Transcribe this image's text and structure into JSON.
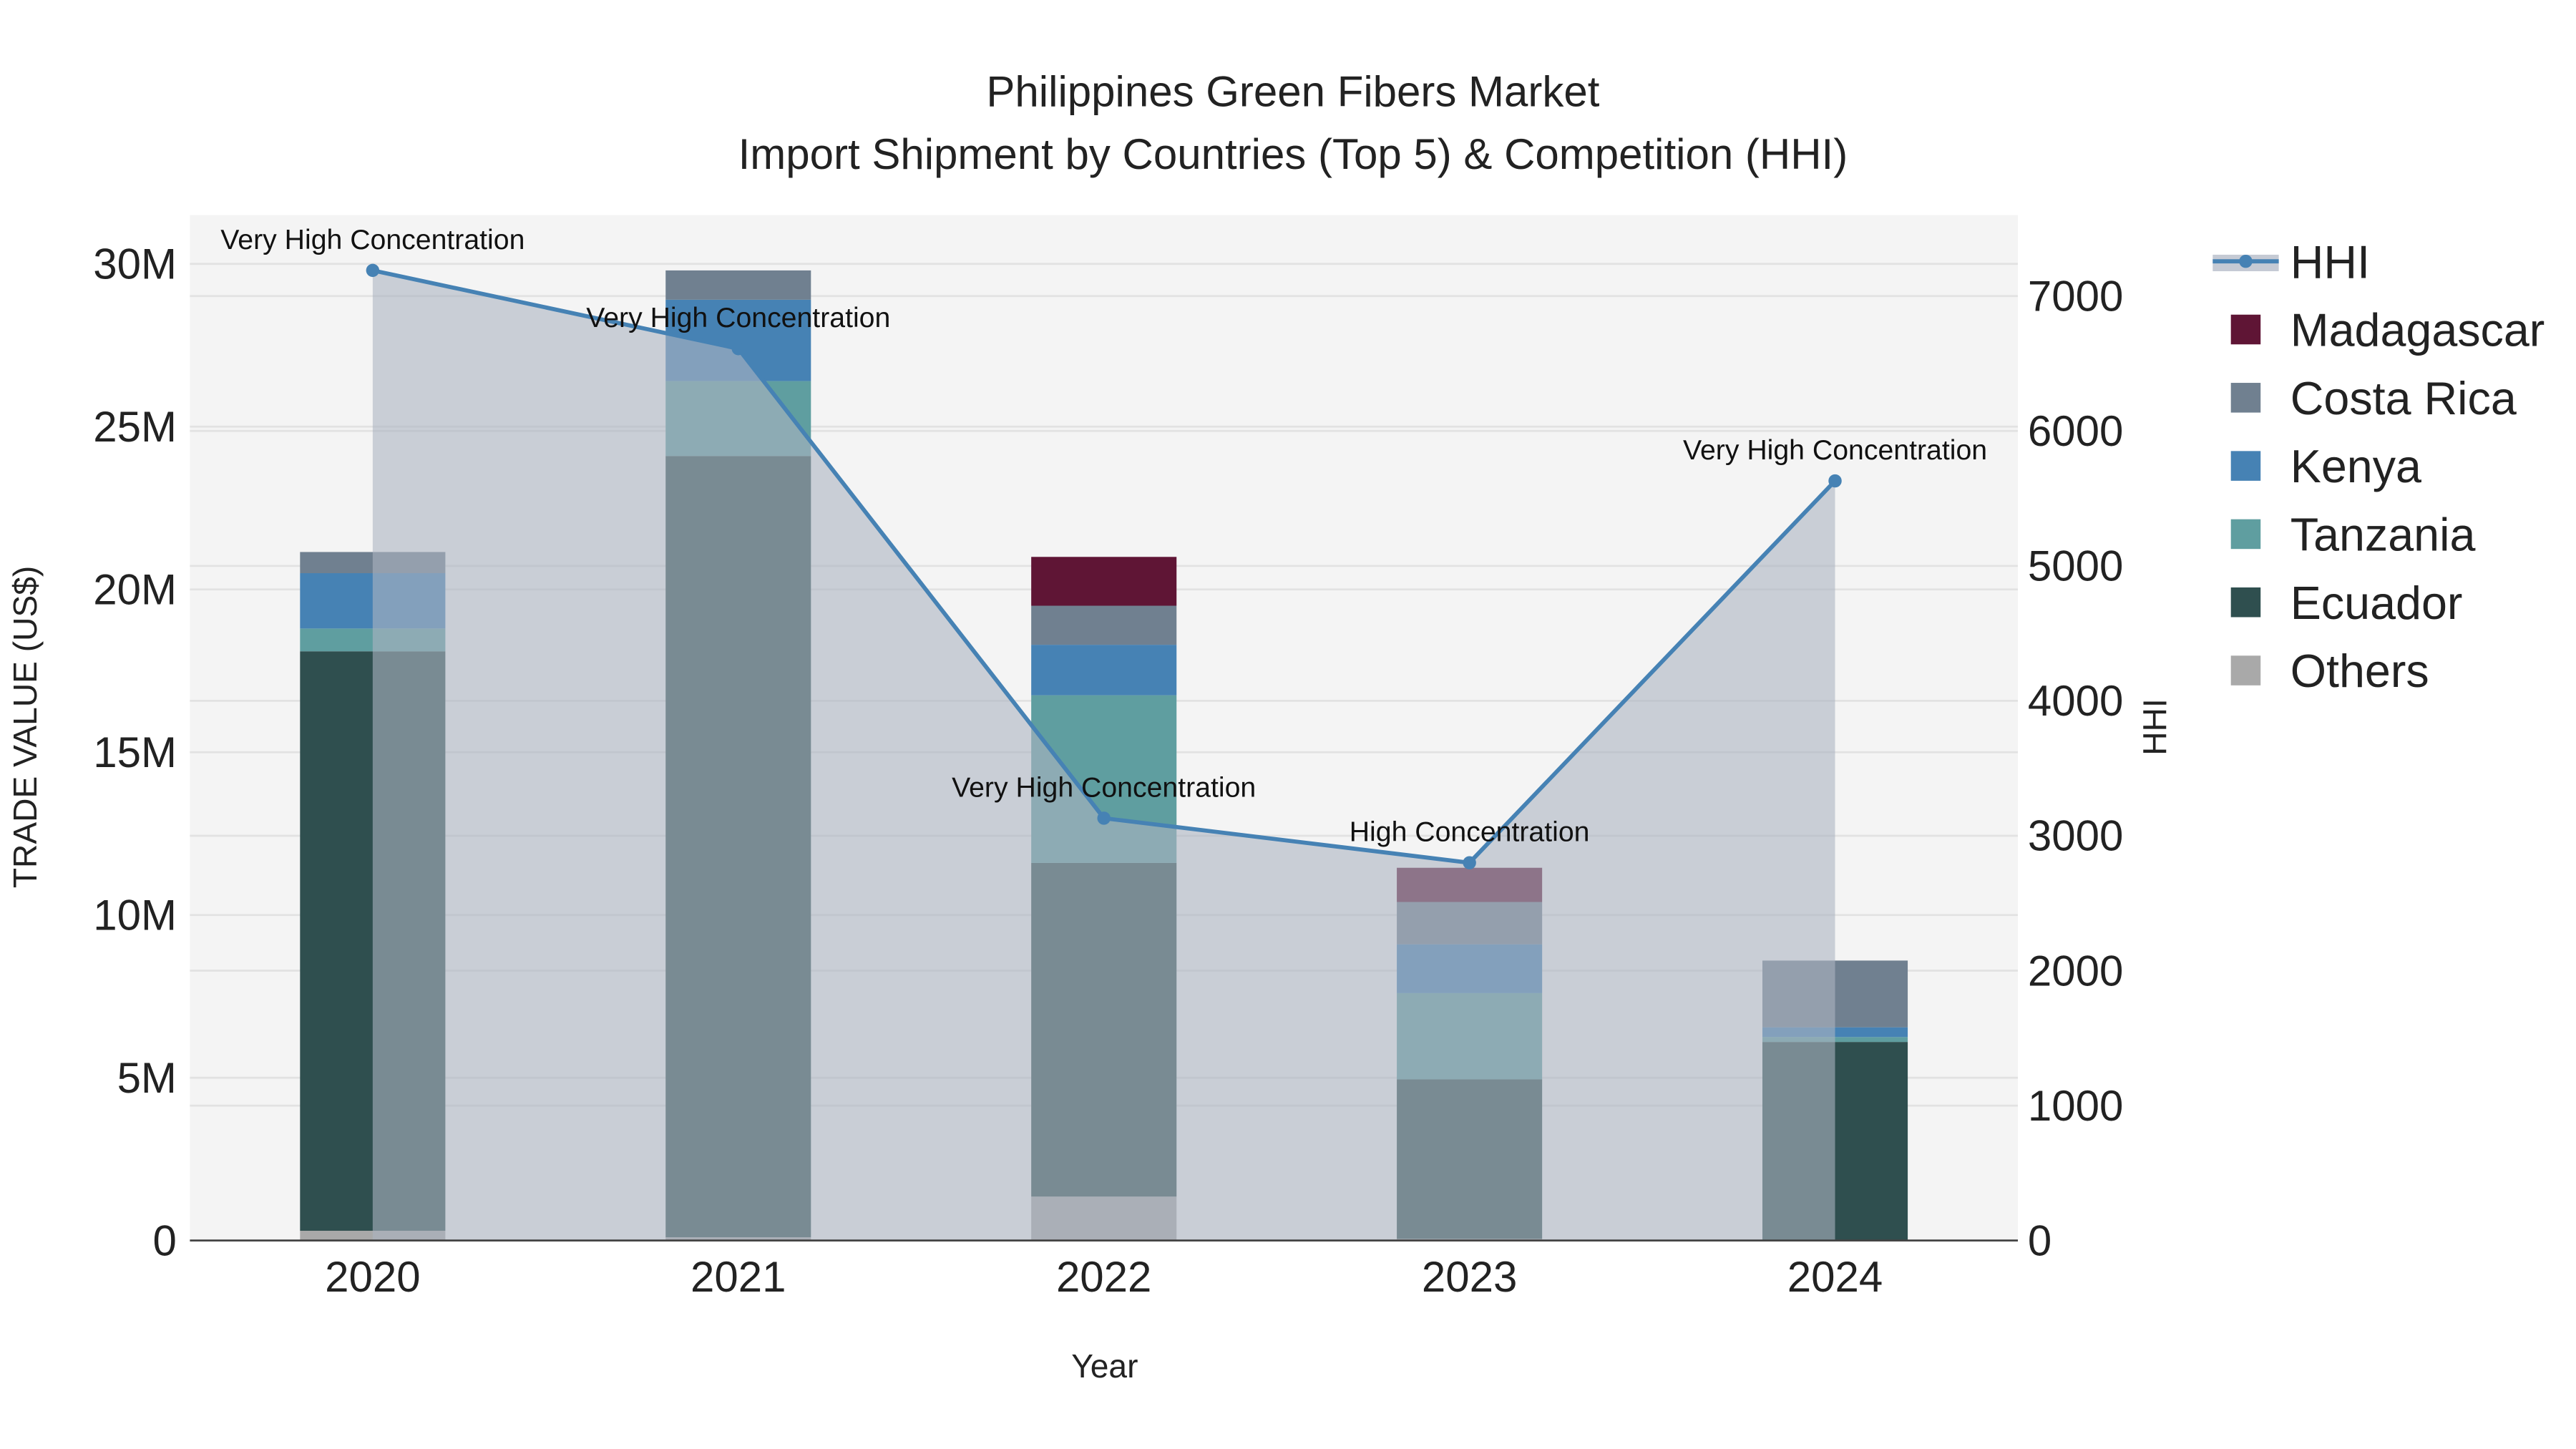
{
  "chart_data": {
    "type": "bar",
    "title": "Philippines Green Fibers Market",
    "subtitle": "Import Shipment by Countries (Top 5) & Competition (HHI)",
    "xlabel": "Year",
    "ylabel": "TRADE VALUE (US$)",
    "y2label": "HHI",
    "categories": [
      "2020",
      "2021",
      "2022",
      "2023",
      "2024"
    ],
    "ylim": [
      0,
      31500000
    ],
    "y2lim": [
      0,
      7600
    ],
    "yticks": [
      0,
      5000000,
      10000000,
      15000000,
      20000000,
      25000000,
      30000000
    ],
    "ytick_labels": [
      "0",
      "5M",
      "10M",
      "15M",
      "20M",
      "25M",
      "30M"
    ],
    "y2ticks": [
      0,
      1000,
      2000,
      3000,
      4000,
      5000,
      6000,
      7000
    ],
    "y2tick_labels": [
      "0",
      "1000",
      "2000",
      "3000",
      "4000",
      "5000",
      "6000",
      "7000"
    ],
    "stacked": true,
    "series": [
      {
        "name": "Others",
        "color": "#a9a9a9",
        "values": [
          300000,
          100000,
          1350000,
          50000,
          0
        ]
      },
      {
        "name": "Ecuador",
        "color": "#2f4f4f",
        "values": [
          17800000,
          24000000,
          10250000,
          4900000,
          6100000
        ]
      },
      {
        "name": "Tanzania",
        "color": "#5f9ea0",
        "values": [
          700000,
          2300000,
          5150000,
          2650000,
          150000
        ]
      },
      {
        "name": "Kenya",
        "color": "#4682b4",
        "values": [
          1700000,
          2500000,
          1550000,
          1500000,
          300000
        ]
      },
      {
        "name": "Costa Rica",
        "color": "#708090",
        "values": [
          650000,
          900000,
          1200000,
          1300000,
          2050000
        ]
      },
      {
        "name": "Madagascar",
        "color": "#5f1535",
        "values": [
          0,
          0,
          1500000,
          1050000,
          0
        ]
      }
    ],
    "line": {
      "name": "HHI",
      "color": "#4682b4",
      "values": [
        7190,
        6610,
        3130,
        2800,
        5630
      ],
      "annotations": [
        "Very High Concentration",
        "Very High Concentration",
        "Very High Concentration",
        "High Concentration",
        "Very High Concentration"
      ]
    },
    "legend": {
      "placement": "right",
      "entries": [
        "HHI",
        "Madagascar",
        "Costa Rica",
        "Kenya",
        "Tanzania",
        "Ecuador",
        "Others"
      ]
    }
  }
}
